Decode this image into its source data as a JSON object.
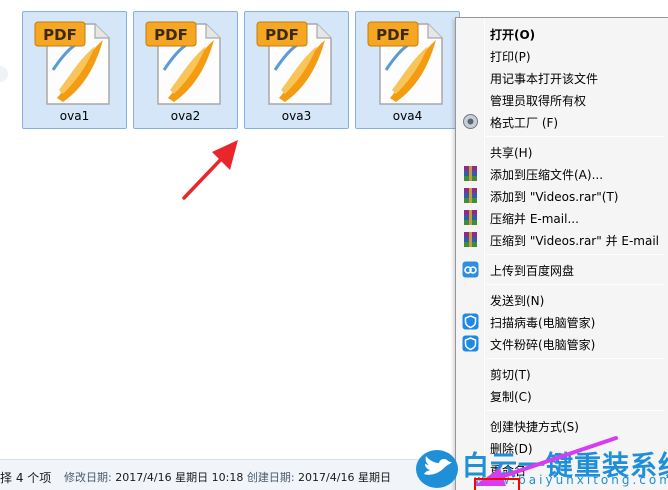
{
  "files": [
    {
      "name": "ova1",
      "icon_text": "PDF"
    },
    {
      "name": "ova2",
      "icon_text": "PDF"
    },
    {
      "name": "ova3",
      "icon_text": "PDF"
    },
    {
      "name": "ova4",
      "icon_text": "PDF"
    }
  ],
  "context_menu": {
    "items": [
      {
        "label": "打开(O)",
        "icon": "",
        "bold": true
      },
      {
        "label": "打印(P)",
        "icon": ""
      },
      {
        "label": "用记事本打开该文件",
        "icon": ""
      },
      {
        "label": "管理员取得所有权",
        "icon": ""
      },
      {
        "label": "格式工厂 (F)",
        "icon": "format-factory-icon"
      },
      {
        "label": "共享(H)",
        "icon": ""
      },
      {
        "label": "添加到压缩文件(A)...",
        "icon": "winrar-icon"
      },
      {
        "label": "添加到 \"Videos.rar\"(T)",
        "icon": "winrar-icon"
      },
      {
        "label": "压缩并 E-mail...",
        "icon": "winrar-icon"
      },
      {
        "label": "压缩到 \"Videos.rar\" 并 E-mail",
        "icon": "winrar-icon"
      },
      {
        "label": "上传到百度网盘",
        "icon": "baidu-netdisk-icon"
      },
      {
        "label": "发送到(N)",
        "icon": ""
      },
      {
        "label": "扫描病毒(电脑管家)",
        "icon": "tencent-pc-manager-icon"
      },
      {
        "label": "文件粉碎(电脑管家)",
        "icon": "tencent-pc-manager-icon"
      },
      {
        "label": "剪切(T)",
        "icon": ""
      },
      {
        "label": "复制(C)",
        "icon": ""
      },
      {
        "label": "创建快捷方式(S)",
        "icon": ""
      },
      {
        "label": "删除(D)",
        "icon": ""
      },
      {
        "label": "重命名",
        "icon": ""
      }
    ]
  },
  "status_bar": {
    "selection": "择 4 个项",
    "modified_label": "修改日期:",
    "modified_value": "2017/4/16 星期日 10:18",
    "created_label": "创建日期:",
    "created_value": "2017/4/16 星期日"
  },
  "watermark": {
    "title": "白云一键重装系统",
    "url": "www.baiyunxitong.com"
  },
  "colors": {
    "selection_fill": "#d4e6f8",
    "selection_border": "#85b3e0",
    "menu_background": "#f5f5f5",
    "arrow_red": "#e8262b",
    "arrow_pink": "#d63cf0",
    "brand_blue": "#1f8fd8"
  }
}
